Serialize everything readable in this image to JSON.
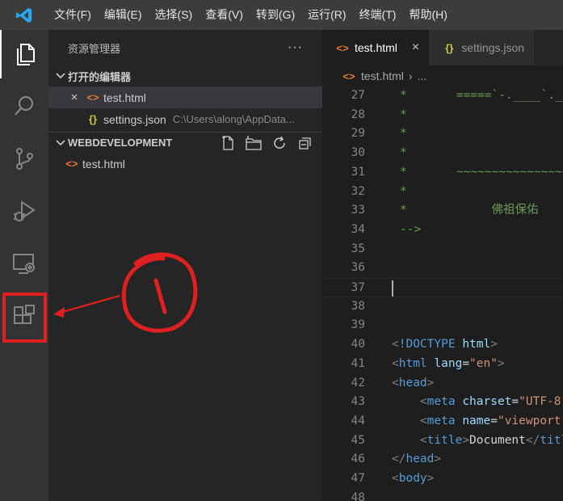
{
  "menu": [
    "文件(F)",
    "编辑(E)",
    "选择(S)",
    "查看(V)",
    "转到(G)",
    "运行(R)",
    "终端(T)",
    "帮助(H)"
  ],
  "explorer": {
    "title": "资源管理器",
    "more": "···",
    "open_editors": {
      "label": "打开的编辑器",
      "items": [
        {
          "name": "test.html",
          "close": "×"
        },
        {
          "name": "settings.json",
          "path": "C:\\Users\\along\\AppData..."
        }
      ]
    },
    "workspace": {
      "label": "WEBDEVELOPMENT",
      "files": [
        "test.html"
      ]
    }
  },
  "tabs": [
    {
      "label": "test.html",
      "close": "×",
      "active": true
    },
    {
      "label": "settings.json",
      "active": false
    }
  ],
  "breadcrumb": {
    "file": "test.html",
    "rest": "..."
  },
  "icon_glyphs": {
    "html": "<>",
    "json": "{}"
  },
  "code_lines": [
    {
      "n": "27",
      "text": "*       =====`-.____`.___"
    },
    {
      "n": "28",
      "text": "*"
    },
    {
      "n": "29",
      "text": "*"
    },
    {
      "n": "30",
      "text": "*"
    },
    {
      "n": "31",
      "text": "*       ~~~~~~~~~~~~~~~~~~~~~"
    },
    {
      "n": "32",
      "text": "*"
    },
    {
      "n": "33",
      "text": "*            佛祖保佑"
    },
    {
      "n": "34",
      "text": "-->"
    },
    {
      "n": "35",
      "text": ""
    },
    {
      "n": "36",
      "text": ""
    },
    {
      "n": "37",
      "text": ""
    },
    {
      "n": "38",
      "text": ""
    },
    {
      "n": "39",
      "text": ""
    },
    {
      "n": "40",
      "text": ""
    },
    {
      "n": "41",
      "text": ""
    },
    {
      "n": "42",
      "text": ""
    },
    {
      "n": "43",
      "text": ""
    },
    {
      "n": "44",
      "text": ""
    },
    {
      "n": "45",
      "text": ""
    },
    {
      "n": "46",
      "text": ""
    },
    {
      "n": "47",
      "text": ""
    },
    {
      "n": "48",
      "text": ""
    }
  ],
  "colors": {
    "accent_html": "#e37933",
    "accent_json": "#cbcb41",
    "annotation_red": "#e02020"
  }
}
